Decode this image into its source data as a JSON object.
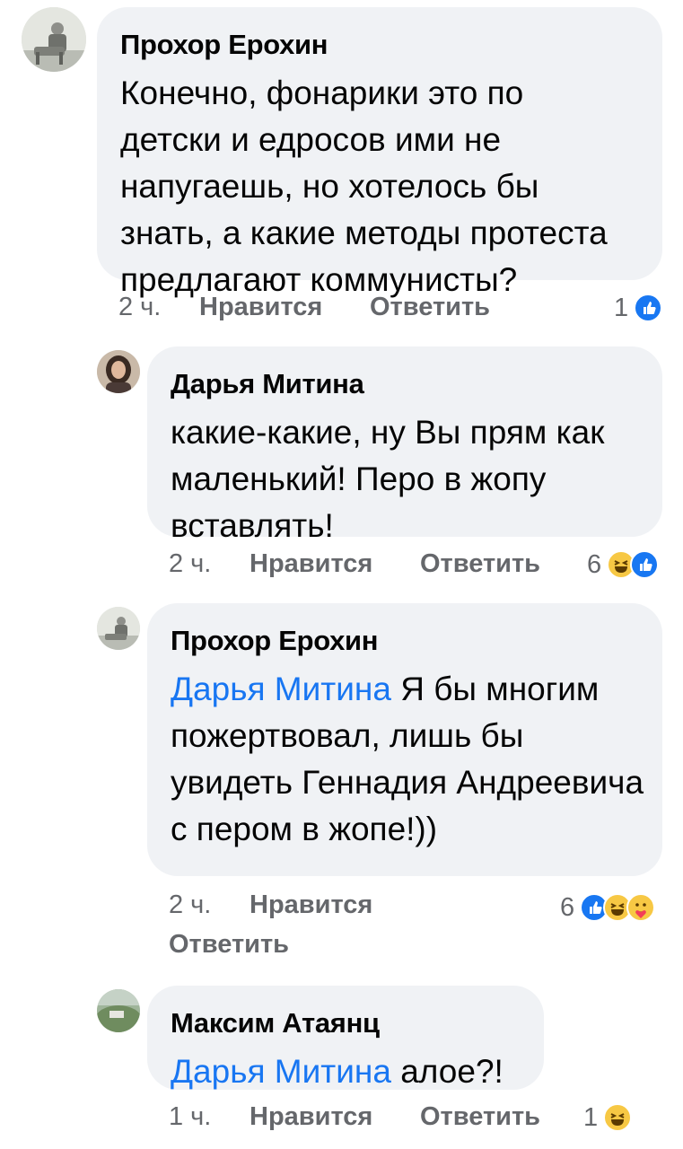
{
  "comments": [
    {
      "author": "Прохор Ерохин",
      "text": "Конечно, фонарики это по детски  и едросов ими не напугаешь, но хотелось бы знать, а какие методы протеста предлагают коммунисты?",
      "time": "2 ч.",
      "like_label": "Нравится",
      "reply_label": "Ответить",
      "reaction_count": "1",
      "reaction_icons": [
        "like-icon"
      ]
    },
    {
      "author": "Дарья Митина",
      "text": "какие-какие, ну Вы прям как маленький! Перо в жопу вставлять!",
      "time": "2 ч.",
      "like_label": "Нравится",
      "reply_label": "Ответить",
      "reaction_count": "6",
      "reaction_icons": [
        "haha-icon",
        "like-icon"
      ]
    },
    {
      "author": "Прохор Ерохин",
      "mention": "Дарья Митина",
      "text": " Я бы многим пожертвовал, лишь бы увидеть Геннадия Андреевича с пером в жопе!))",
      "time": "2 ч.",
      "like_label": "Нравится",
      "reply_label": "Ответить",
      "reaction_count": "6",
      "reaction_icons": [
        "like-icon",
        "haha-icon",
        "care-icon"
      ]
    },
    {
      "author": "Максим Атаянц",
      "mention": "Дарья Митина",
      "text": " алое?!",
      "time": "1 ч.",
      "like_label": "Нравится",
      "reply_label": "Ответить",
      "reaction_count": "1",
      "reaction_icons": [
        "haha-icon"
      ]
    }
  ],
  "colors": {
    "bubble": "#f0f2f5",
    "mention": "#1876f2",
    "meta": "#65676b",
    "like": "#1877f2",
    "haha": "#f7c844"
  }
}
